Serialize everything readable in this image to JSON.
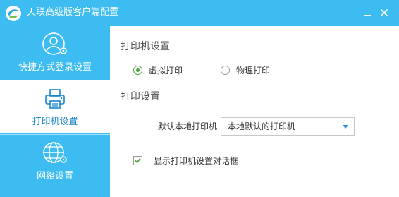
{
  "window": {
    "title": "天联高级版客户端配置",
    "minimize_glyph": "—",
    "close_glyph": "×"
  },
  "colors": {
    "accent": "#3cbcf0",
    "active_label": "#1a86c8",
    "radio_check": "#4aa43a",
    "dropdown_arrow": "#2f8fd8"
  },
  "sidebar": {
    "items": [
      {
        "label": "快捷方式登录设置",
        "icon": "user-gear-icon",
        "active": false
      },
      {
        "label": "打印机设置",
        "icon": "printer-icon",
        "active": true
      },
      {
        "label": "网络设置",
        "icon": "globe-gear-icon",
        "active": false
      }
    ]
  },
  "main": {
    "printer_section": {
      "title": "打印机设置",
      "options": [
        {
          "label": "虚拟打印",
          "selected": true
        },
        {
          "label": "物理打印",
          "selected": false
        }
      ]
    },
    "print_section": {
      "title": "打印设置",
      "default_printer_label": "默认本地打印机",
      "default_printer_value": "本地默认的打印机",
      "show_dialog_label": "显示打印机设置对话框",
      "show_dialog_checked": true
    }
  }
}
